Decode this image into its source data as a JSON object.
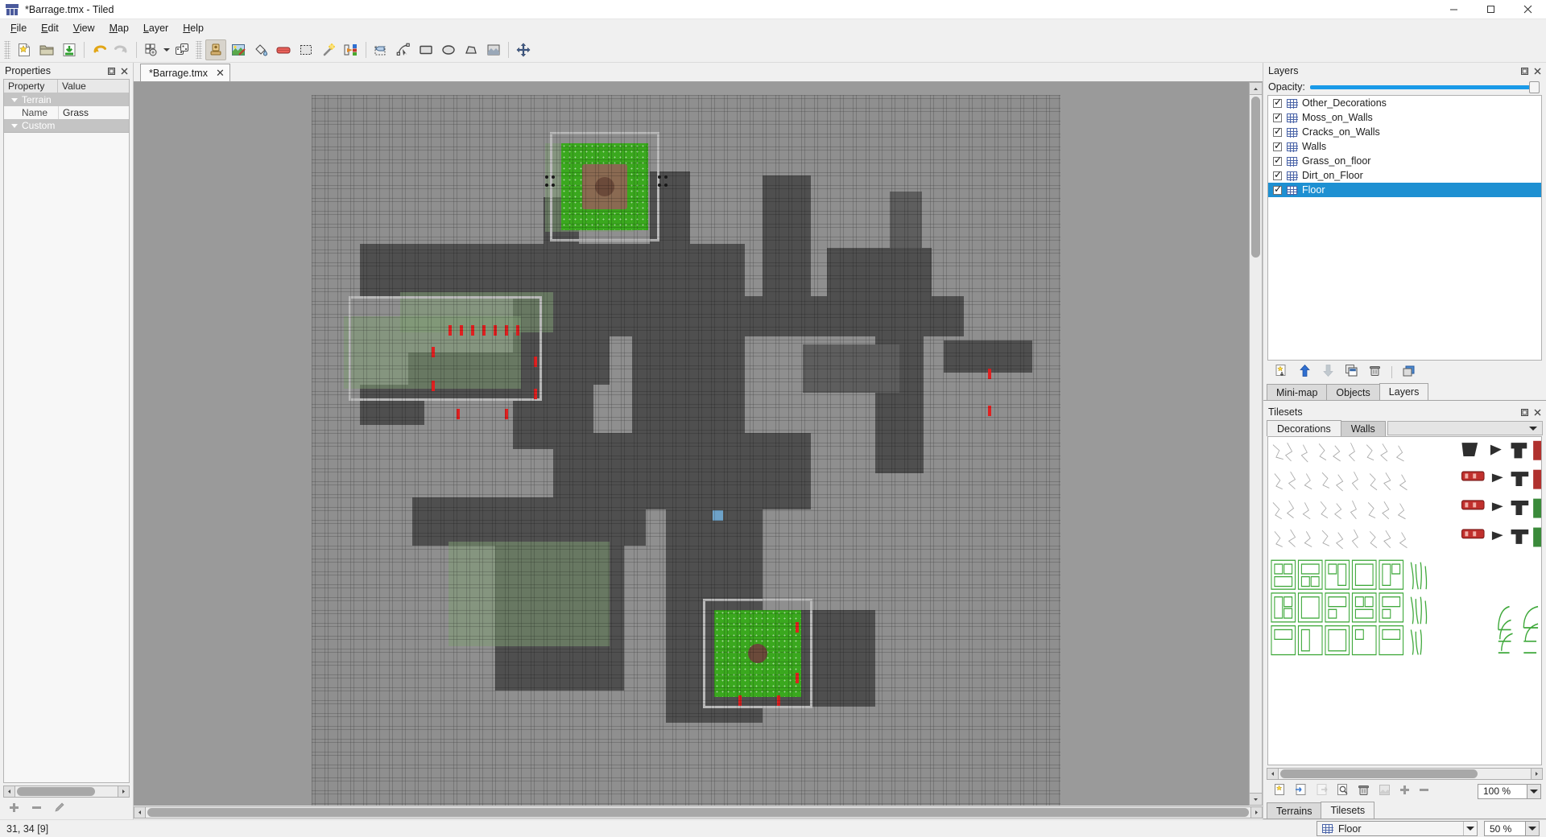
{
  "window": {
    "title": "*Barrage.tmx - Tiled",
    "app_icon": "tiled-logo-icon",
    "minimize": "minimize-icon",
    "maximize": "maximize-icon",
    "close": "close-icon"
  },
  "menubar": [
    {
      "label": "File",
      "mnemonic": "F"
    },
    {
      "label": "Edit",
      "mnemonic": "E"
    },
    {
      "label": "View",
      "mnemonic": "V"
    },
    {
      "label": "Map",
      "mnemonic": "M"
    },
    {
      "label": "Layer",
      "mnemonic": "L"
    },
    {
      "label": "Help",
      "mnemonic": "H"
    }
  ],
  "toolbar": [
    {
      "name": "new-map-button",
      "icon": "new-file-icon"
    },
    {
      "name": "open-file-button",
      "icon": "open-folder-icon"
    },
    {
      "name": "save-file-button",
      "icon": "save-disk-icon"
    },
    {
      "name": "undo-button",
      "icon": "undo-arrow-icon"
    },
    {
      "name": "redo-button",
      "icon": "redo-arrow-icon"
    },
    {
      "name": "edit-tilesets-button",
      "icon": "tileset-gear-icon"
    },
    {
      "name": "random-mode-button",
      "icon": "dice-icon"
    },
    {
      "name": "stamp-brush-button",
      "icon": "stamp-brush-icon"
    },
    {
      "name": "terrain-brush-button",
      "icon": "terrain-brush-icon"
    },
    {
      "name": "bucket-fill-button",
      "icon": "paint-bucket-icon"
    },
    {
      "name": "eraser-button",
      "icon": "eraser-icon"
    },
    {
      "name": "rectangle-select-button",
      "icon": "rectangle-select-icon"
    },
    {
      "name": "magic-wand-button",
      "icon": "magic-wand-icon"
    },
    {
      "name": "select-same-tile-button",
      "icon": "select-same-tile-icon"
    },
    {
      "name": "select-object-button",
      "icon": "object-select-icon"
    },
    {
      "name": "edit-polygons-button",
      "icon": "edit-polygon-icon"
    },
    {
      "name": "insert-rectangle-button",
      "icon": "insert-rectangle-icon"
    },
    {
      "name": "insert-ellipse-button",
      "icon": "insert-ellipse-icon"
    },
    {
      "name": "insert-polygon-button",
      "icon": "insert-polygon-icon"
    },
    {
      "name": "insert-tile-button",
      "icon": "insert-tile-icon"
    },
    {
      "name": "pan-tool-button",
      "icon": "pan-move-icon"
    }
  ],
  "properties_panel": {
    "title": "Properties",
    "float_icon": "float-panel-icon",
    "close_icon": "close-panel-icon",
    "columns": [
      "Property",
      "Value"
    ],
    "rows": [
      {
        "type": "group",
        "key": "Terrain",
        "value": ""
      },
      {
        "type": "sub",
        "key": "Name",
        "value": "Grass"
      },
      {
        "type": "group",
        "key": "Custom Properties",
        "value": ""
      }
    ],
    "buttons": [
      {
        "name": "add-property-button",
        "icon": "plus-icon"
      },
      {
        "name": "remove-property-button",
        "icon": "minus-icon"
      },
      {
        "name": "edit-property-button",
        "icon": "pencil-icon"
      }
    ]
  },
  "document_tabs": [
    {
      "label": "*Barrage.tmx",
      "close": "close-tab-icon",
      "active": true
    }
  ],
  "layers_panel": {
    "title": "Layers",
    "float_icon": "float-panel-icon",
    "close_icon": "close-panel-icon",
    "opacity_label": "Opacity:",
    "opacity_value": 100,
    "items": [
      {
        "label": "Other_Decorations",
        "visible": true,
        "selected": false
      },
      {
        "label": "Moss_on_Walls",
        "visible": true,
        "selected": false
      },
      {
        "label": "Cracks_on_Walls",
        "visible": true,
        "selected": false
      },
      {
        "label": "Walls",
        "visible": true,
        "selected": false
      },
      {
        "label": "Grass_on_floor",
        "visible": true,
        "selected": false
      },
      {
        "label": "Dirt_on_Floor",
        "visible": true,
        "selected": false
      },
      {
        "label": "Floor",
        "visible": true,
        "selected": true
      }
    ],
    "buttons": [
      {
        "name": "new-layer-button",
        "icon": "new-layer-icon"
      },
      {
        "name": "move-layer-up-button",
        "icon": "arrow-up-icon"
      },
      {
        "name": "move-layer-down-button",
        "icon": "arrow-down-icon"
      },
      {
        "name": "duplicate-layer-button",
        "icon": "duplicate-layer-icon"
      },
      {
        "name": "delete-layer-button",
        "icon": "trash-icon"
      },
      {
        "name": "layer-properties-button",
        "icon": "layer-properties-icon"
      }
    ],
    "tabs": [
      {
        "label": "Mini-map",
        "active": false
      },
      {
        "label": "Objects",
        "active": false
      },
      {
        "label": "Layers",
        "active": true
      }
    ]
  },
  "tilesets_panel": {
    "title": "Tilesets",
    "float_icon": "float-panel-icon",
    "close_icon": "close-panel-icon",
    "tabs": [
      {
        "label": "Decorations",
        "active": true
      },
      {
        "label": "Walls",
        "active": false
      }
    ],
    "dropdown_icon": "chevron-down-icon",
    "zoom_value": "100 %",
    "zoom_dropdown_icon": "chevron-down-icon",
    "buttons": [
      {
        "name": "new-tileset-button",
        "icon": "new-tileset-icon"
      },
      {
        "name": "import-tileset-button",
        "icon": "import-icon"
      },
      {
        "name": "export-tileset-button",
        "icon": "export-icon"
      },
      {
        "name": "edit-tileset-button",
        "icon": "edit-tileset-icon"
      },
      {
        "name": "remove-tileset-button",
        "icon": "trash-icon"
      },
      {
        "name": "tileset-properties-button",
        "icon": "tileset-properties-icon"
      },
      {
        "name": "zoom-in-button",
        "icon": "plus-icon"
      },
      {
        "name": "zoom-out-button",
        "icon": "minus-icon"
      }
    ],
    "bottom_tabs": [
      {
        "label": "Terrains",
        "active": false
      },
      {
        "label": "Tilesets",
        "active": true
      }
    ]
  },
  "statusbar": {
    "coordinates": "31, 34 [9]",
    "current_layer": "Floor",
    "current_layer_icon": "grid-layer-icon",
    "layer_dropdown_icon": "chevron-down-icon",
    "zoom": "50 %",
    "zoom_dropdown_icon": "chevron-down-icon"
  },
  "colors": {
    "selection_blue": "#1e90d2",
    "slider_blue": "#1a9ae8",
    "grass_green": "#3aa81e",
    "marker_red": "#e02020",
    "marker_blue": "#6ea2c8",
    "floor_gray": "#4f4f4f",
    "wall_light": "#b9b9b9",
    "canvas_bg": "#9a9a9a"
  }
}
